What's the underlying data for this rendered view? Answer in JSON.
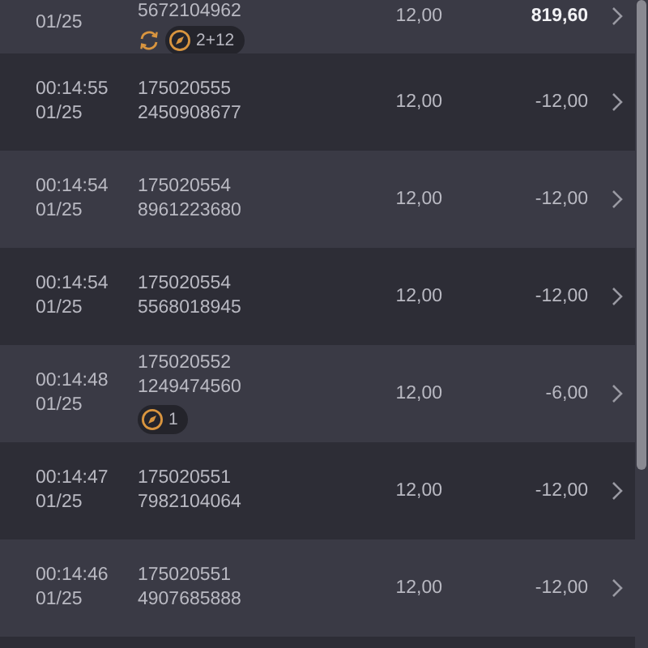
{
  "rows": [
    {
      "time": null,
      "date": "01/25",
      "order": null,
      "ticket": "5672104962",
      "badges": [
        {
          "kind": "refresh"
        },
        {
          "kind": "compass",
          "count": "2+12"
        }
      ],
      "stake": "12,00",
      "result": "819,60",
      "bold": true
    },
    {
      "time": "00:14:55",
      "date": "01/25",
      "order": "175020555",
      "ticket": "2450908677",
      "badges": [],
      "stake": "12,00",
      "result": "-12,00",
      "bold": false
    },
    {
      "time": "00:14:54",
      "date": "01/25",
      "order": "175020554",
      "ticket": "8961223680",
      "badges": [],
      "stake": "12,00",
      "result": "-12,00",
      "bold": false
    },
    {
      "time": "00:14:54",
      "date": "01/25",
      "order": "175020554",
      "ticket": "5568018945",
      "badges": [],
      "stake": "12,00",
      "result": "-12,00",
      "bold": false
    },
    {
      "time": "00:14:48",
      "date": "01/25",
      "order": "175020552",
      "ticket": "1249474560",
      "badges": [
        {
          "kind": "compass",
          "count": "1"
        }
      ],
      "stake": "12,00",
      "result": "-6,00",
      "bold": false
    },
    {
      "time": "00:14:47",
      "date": "01/25",
      "order": "175020551",
      "ticket": "7982104064",
      "badges": [],
      "stake": "12,00",
      "result": "-12,00",
      "bold": false
    },
    {
      "time": "00:14:46",
      "date": "01/25",
      "order": "175020551",
      "ticket": "4907685888",
      "badges": [],
      "stake": "12,00",
      "result": "-12,00",
      "bold": false
    }
  ]
}
